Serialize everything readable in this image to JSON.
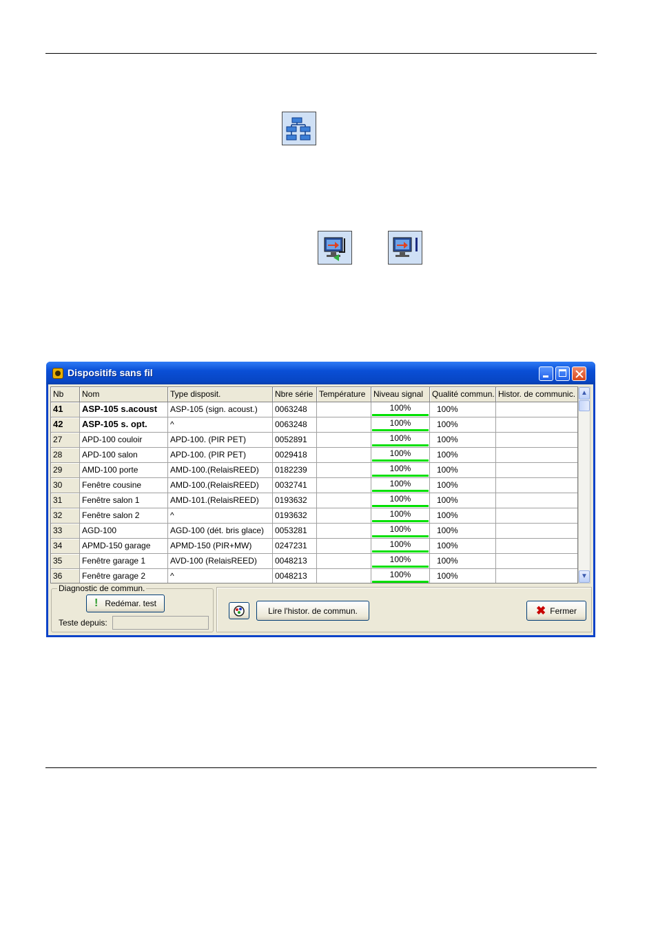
{
  "toolbar_icons": [
    "network-tree-icon",
    "monitor-transfer-icon",
    "monitor-info-icon"
  ],
  "window": {
    "title": "Dispositifs sans fil",
    "columns": [
      "Nb",
      "Nom",
      "Type disposit.",
      "Nbre série",
      "Température",
      "Niveau signal",
      "Qualité commun.",
      "Histor. de communic."
    ],
    "rows": [
      {
        "nb": "41",
        "nom": "ASP-105 s.acoust",
        "type": "ASP-105 (sign. acoust.)",
        "serie": "0063248",
        "temp": "",
        "signal": "100%",
        "signal_level": 1.0,
        "qualite": "100%",
        "histor": "",
        "bold": true
      },
      {
        "nb": "42",
        "nom": "ASP-105 s. opt.",
        "type": "^",
        "serie": "0063248",
        "temp": "",
        "signal": "100%",
        "signal_level": 1.0,
        "qualite": "100%",
        "histor": "",
        "bold": true
      },
      {
        "nb": "27",
        "nom": "APD-100 couloir",
        "type": "APD-100. (PIR PET)",
        "serie": "0052891",
        "temp": "",
        "signal": "100%",
        "signal_level": 1.0,
        "qualite": "100%",
        "histor": "",
        "bold": false
      },
      {
        "nb": "28",
        "nom": "APD-100 salon",
        "type": "APD-100. (PIR PET)",
        "serie": "0029418",
        "temp": "",
        "signal": "100%",
        "signal_level": 1.0,
        "qualite": "100%",
        "histor": "",
        "bold": false
      },
      {
        "nb": "29",
        "nom": "AMD-100 porte",
        "type": "AMD-100.(RelaisREED)",
        "serie": "0182239",
        "temp": "",
        "signal": "100%",
        "signal_level": 1.0,
        "qualite": "100%",
        "histor": "",
        "bold": false
      },
      {
        "nb": "30",
        "nom": "Fenêtre cousine",
        "type": "AMD-100.(RelaisREED)",
        "serie": "0032741",
        "temp": "",
        "signal": "100%",
        "signal_level": 1.0,
        "qualite": "100%",
        "histor": "",
        "bold": false
      },
      {
        "nb": "31",
        "nom": "Fenêtre salon 1",
        "type": "AMD-101.(RelaisREED)",
        "serie": "0193632",
        "temp": "",
        "signal": "100%",
        "signal_level": 1.0,
        "qualite": "100%",
        "histor": "",
        "bold": false
      },
      {
        "nb": "32",
        "nom": "Fenêtre salon 2",
        "type": "^",
        "serie": "0193632",
        "temp": "",
        "signal": "100%",
        "signal_level": 1.0,
        "qualite": "100%",
        "histor": "",
        "bold": false
      },
      {
        "nb": "33",
        "nom": "AGD-100",
        "type": "AGD-100 (dét. bris glace)",
        "serie": "0053281",
        "temp": "",
        "signal": "100%",
        "signal_level": 1.0,
        "qualite": "100%",
        "histor": "",
        "bold": false
      },
      {
        "nb": "34",
        "nom": "APMD-150 garage",
        "type": "APMD-150 (PIR+MW)",
        "serie": "0247231",
        "temp": "",
        "signal": "100%",
        "signal_level": 1.0,
        "qualite": "100%",
        "histor": "",
        "bold": false
      },
      {
        "nb": "35",
        "nom": "Fenêtre garage 1",
        "type": "AVD-100 (RelaisREED)",
        "serie": "0048213",
        "temp": "",
        "signal": "100%",
        "signal_level": 1.0,
        "qualite": "100%",
        "histor": "",
        "bold": false
      },
      {
        "nb": "36",
        "nom": "Fenêtre garage 2",
        "type": "^",
        "serie": "0048213",
        "temp": "",
        "signal": "100%",
        "signal_level": 1.0,
        "qualite": "100%",
        "histor": "",
        "bold": false
      }
    ],
    "diag_group_title": "Diagnostic de commun.",
    "restart_label": "Redémar. test",
    "since_label": "Teste depuis:",
    "since_value": "",
    "read_history_label": "Lire l'histor. de commun.",
    "close_label": "Fermer",
    "colors": {
      "signal_bar": "#00e000",
      "title_bar": "#0a4fd6",
      "close_x": "#c80000"
    }
  }
}
